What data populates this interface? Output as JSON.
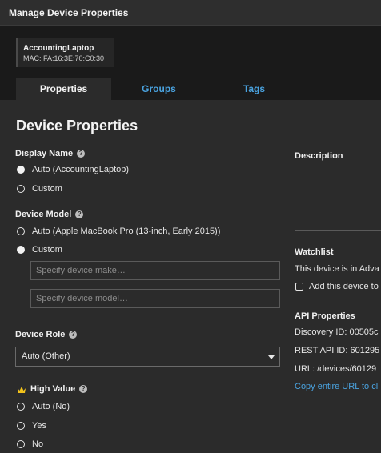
{
  "window": {
    "title": "Manage Device Properties"
  },
  "device": {
    "name": "AccountingLaptop",
    "mac": "MAC: FA:16:3E:70:C0:30"
  },
  "tabs": [
    {
      "label": "Properties",
      "active": true
    },
    {
      "label": "Groups",
      "active": false
    },
    {
      "label": "Tags",
      "active": false
    }
  ],
  "main": {
    "heading": "Device Properties",
    "display_name": {
      "label": "Display Name",
      "options": [
        {
          "label": "Auto  (AccountingLaptop)",
          "selected": true
        },
        {
          "label": "Custom",
          "selected": false
        }
      ]
    },
    "device_model": {
      "label": "Device Model",
      "options": [
        {
          "label": "Auto  (Apple MacBook Pro (13-inch, Early 2015))",
          "selected": false
        },
        {
          "label": "Custom",
          "selected": true
        }
      ],
      "make_placeholder": "Specify device make…",
      "model_placeholder": "Specify device model…"
    },
    "device_role": {
      "label": "Device Role",
      "value": "Auto (Other)"
    },
    "high_value": {
      "label": "High Value",
      "options": [
        {
          "label": "Auto (No)",
          "selected": false
        },
        {
          "label": "Yes",
          "selected": false
        },
        {
          "label": "No",
          "selected": false
        }
      ]
    }
  },
  "right": {
    "description": {
      "label": "Description"
    },
    "watchlist": {
      "label": "Watchlist",
      "text": "This device is in Adva",
      "checkbox_label": "Add this device to"
    },
    "api": {
      "label": "API Properties",
      "discovery_id": "Discovery ID: 00505c",
      "rest_api_id": "REST API ID: 601295",
      "url": "URL: /devices/60129",
      "copy_link": "Copy entire URL to cl"
    }
  },
  "colors": {
    "accent": "#4aa3e0",
    "crown": "#f2c21b",
    "background": "#2b2b2b"
  }
}
